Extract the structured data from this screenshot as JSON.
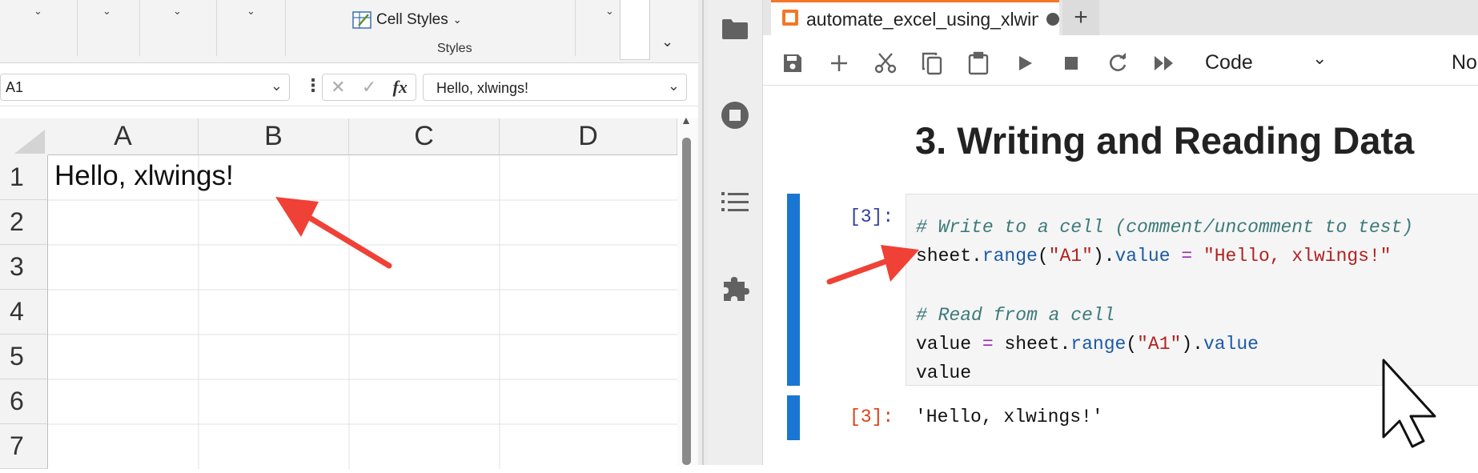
{
  "excel": {
    "ribbon": {
      "cell_styles_label": "Cell Styles",
      "styles_group_label": "Styles",
      "dropdown_chevron": "⌄"
    },
    "name_box": {
      "value": "A1"
    },
    "formula": {
      "value": "Hello, xlwings!",
      "fx_label": "fx",
      "cancel_glyph": "✕",
      "enter_glyph": "✓"
    },
    "columns": [
      "A",
      "B",
      "C",
      "D"
    ],
    "rows": [
      "1",
      "2",
      "3",
      "4",
      "5",
      "6",
      "7"
    ],
    "cell_a1": "Hello, xlwings!"
  },
  "jupyter": {
    "sidebar_icons": [
      "folder-icon",
      "running-kernels-icon",
      "table-of-contents-icon",
      "extensions-icon"
    ],
    "tab": {
      "title": "automate_excel_using_xlwings",
      "new_tab_label": "+"
    },
    "toolbar": {
      "icons": [
        "save-icon",
        "add-cell-icon",
        "cut-icon",
        "copy-icon",
        "paste-icon",
        "run-icon",
        "stop-icon",
        "restart-icon",
        "run-all-icon"
      ],
      "cell_type": "Code",
      "kernel_label": "No"
    },
    "markdown_heading": "3. Writing and Reading Data",
    "code_cell": {
      "in_prompt": "[3]:",
      "line1": "# Write to a cell (comment/uncomment to test)",
      "line2_obj": "sheet",
      "line2_dot1": ".",
      "line2_method": "range",
      "line2_arg": "\"A1\"",
      "line2_attr": "value",
      "line2_eq": "=",
      "line2_str": "\"Hello, xlwings!\"",
      "line4": "# Read from a cell",
      "line5_var": "value",
      "line5_eq": "=",
      "line5_obj": "sheet",
      "line5_method": "range",
      "line5_arg": "\"A1\"",
      "line5_attr": "value",
      "line6": "value"
    },
    "output_cell": {
      "out_prompt": "[3]:",
      "text": "'Hello, xlwings!'"
    }
  },
  "colors": {
    "jupyter_blue": "#1976d2",
    "jupyter_orange": "#f37726",
    "arrow_red": "#ef4136"
  }
}
